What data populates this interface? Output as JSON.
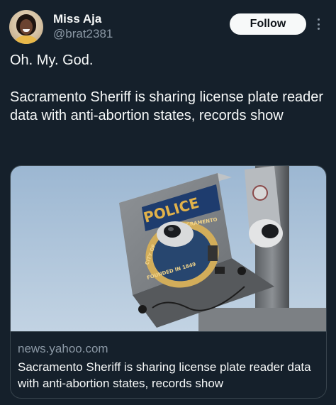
{
  "user": {
    "name": "Miss Aja",
    "handle": "@brat2381",
    "avatar_icon": "profile-avatar"
  },
  "actions": {
    "follow_label": "Follow",
    "more_icon": "more-vertical-icon"
  },
  "tweet": {
    "text": "Oh. My. God.\n\nSacramento Sheriff is sharing license plate reader data with anti-abortion states, records show"
  },
  "card": {
    "image_sign_text": "POLICE",
    "seal_top_text": "SACRAMENTO",
    "seal_left_text": "CITY OF",
    "seal_bottom_text": "FOUNDED IN 1849",
    "domain": "news.yahoo.com",
    "title": "Sacramento Sheriff is sharing license plate reader data with anti-abortion states, records show"
  },
  "colors": {
    "background": "#15202b",
    "text": "#f7f9f9",
    "secondary_text": "#8b98a5",
    "border": "#38444d",
    "follow_bg": "#f7f9f9"
  }
}
